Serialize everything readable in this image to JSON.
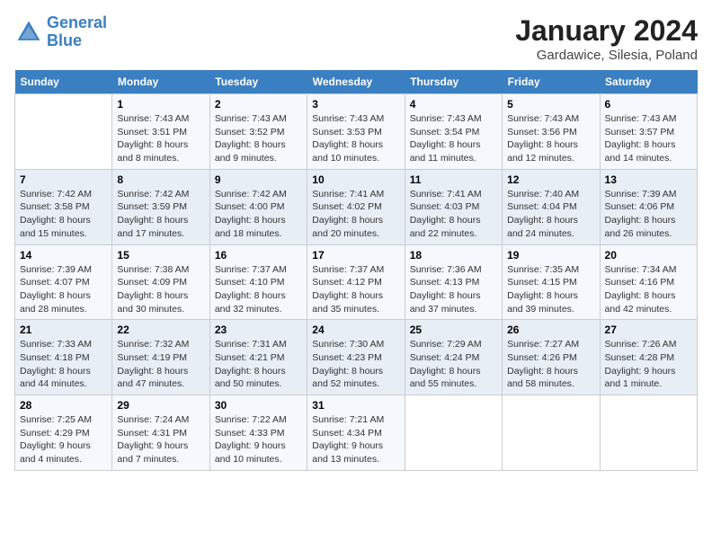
{
  "header": {
    "logo_text_part1": "General",
    "logo_text_part2": "Blue",
    "title": "January 2024",
    "subtitle": "Gardawice, Silesia, Poland"
  },
  "calendar": {
    "days_of_week": [
      "Sunday",
      "Monday",
      "Tuesday",
      "Wednesday",
      "Thursday",
      "Friday",
      "Saturday"
    ],
    "weeks": [
      [
        {
          "day": "",
          "info": ""
        },
        {
          "day": "1",
          "info": "Sunrise: 7:43 AM\nSunset: 3:51 PM\nDaylight: 8 hours\nand 8 minutes."
        },
        {
          "day": "2",
          "info": "Sunrise: 7:43 AM\nSunset: 3:52 PM\nDaylight: 8 hours\nand 9 minutes."
        },
        {
          "day": "3",
          "info": "Sunrise: 7:43 AM\nSunset: 3:53 PM\nDaylight: 8 hours\nand 10 minutes."
        },
        {
          "day": "4",
          "info": "Sunrise: 7:43 AM\nSunset: 3:54 PM\nDaylight: 8 hours\nand 11 minutes."
        },
        {
          "day": "5",
          "info": "Sunrise: 7:43 AM\nSunset: 3:56 PM\nDaylight: 8 hours\nand 12 minutes."
        },
        {
          "day": "6",
          "info": "Sunrise: 7:43 AM\nSunset: 3:57 PM\nDaylight: 8 hours\nand 14 minutes."
        }
      ],
      [
        {
          "day": "7",
          "info": "Sunrise: 7:42 AM\nSunset: 3:58 PM\nDaylight: 8 hours\nand 15 minutes."
        },
        {
          "day": "8",
          "info": "Sunrise: 7:42 AM\nSunset: 3:59 PM\nDaylight: 8 hours\nand 17 minutes."
        },
        {
          "day": "9",
          "info": "Sunrise: 7:42 AM\nSunset: 4:00 PM\nDaylight: 8 hours\nand 18 minutes."
        },
        {
          "day": "10",
          "info": "Sunrise: 7:41 AM\nSunset: 4:02 PM\nDaylight: 8 hours\nand 20 minutes."
        },
        {
          "day": "11",
          "info": "Sunrise: 7:41 AM\nSunset: 4:03 PM\nDaylight: 8 hours\nand 22 minutes."
        },
        {
          "day": "12",
          "info": "Sunrise: 7:40 AM\nSunset: 4:04 PM\nDaylight: 8 hours\nand 24 minutes."
        },
        {
          "day": "13",
          "info": "Sunrise: 7:39 AM\nSunset: 4:06 PM\nDaylight: 8 hours\nand 26 minutes."
        }
      ],
      [
        {
          "day": "14",
          "info": "Sunrise: 7:39 AM\nSunset: 4:07 PM\nDaylight: 8 hours\nand 28 minutes."
        },
        {
          "day": "15",
          "info": "Sunrise: 7:38 AM\nSunset: 4:09 PM\nDaylight: 8 hours\nand 30 minutes."
        },
        {
          "day": "16",
          "info": "Sunrise: 7:37 AM\nSunset: 4:10 PM\nDaylight: 8 hours\nand 32 minutes."
        },
        {
          "day": "17",
          "info": "Sunrise: 7:37 AM\nSunset: 4:12 PM\nDaylight: 8 hours\nand 35 minutes."
        },
        {
          "day": "18",
          "info": "Sunrise: 7:36 AM\nSunset: 4:13 PM\nDaylight: 8 hours\nand 37 minutes."
        },
        {
          "day": "19",
          "info": "Sunrise: 7:35 AM\nSunset: 4:15 PM\nDaylight: 8 hours\nand 39 minutes."
        },
        {
          "day": "20",
          "info": "Sunrise: 7:34 AM\nSunset: 4:16 PM\nDaylight: 8 hours\nand 42 minutes."
        }
      ],
      [
        {
          "day": "21",
          "info": "Sunrise: 7:33 AM\nSunset: 4:18 PM\nDaylight: 8 hours\nand 44 minutes."
        },
        {
          "day": "22",
          "info": "Sunrise: 7:32 AM\nSunset: 4:19 PM\nDaylight: 8 hours\nand 47 minutes."
        },
        {
          "day": "23",
          "info": "Sunrise: 7:31 AM\nSunset: 4:21 PM\nDaylight: 8 hours\nand 50 minutes."
        },
        {
          "day": "24",
          "info": "Sunrise: 7:30 AM\nSunset: 4:23 PM\nDaylight: 8 hours\nand 52 minutes."
        },
        {
          "day": "25",
          "info": "Sunrise: 7:29 AM\nSunset: 4:24 PM\nDaylight: 8 hours\nand 55 minutes."
        },
        {
          "day": "26",
          "info": "Sunrise: 7:27 AM\nSunset: 4:26 PM\nDaylight: 8 hours\nand 58 minutes."
        },
        {
          "day": "27",
          "info": "Sunrise: 7:26 AM\nSunset: 4:28 PM\nDaylight: 9 hours\nand 1 minute."
        }
      ],
      [
        {
          "day": "28",
          "info": "Sunrise: 7:25 AM\nSunset: 4:29 PM\nDaylight: 9 hours\nand 4 minutes."
        },
        {
          "day": "29",
          "info": "Sunrise: 7:24 AM\nSunset: 4:31 PM\nDaylight: 9 hours\nand 7 minutes."
        },
        {
          "day": "30",
          "info": "Sunrise: 7:22 AM\nSunset: 4:33 PM\nDaylight: 9 hours\nand 10 minutes."
        },
        {
          "day": "31",
          "info": "Sunrise: 7:21 AM\nSunset: 4:34 PM\nDaylight: 9 hours\nand 13 minutes."
        },
        {
          "day": "",
          "info": ""
        },
        {
          "day": "",
          "info": ""
        },
        {
          "day": "",
          "info": ""
        }
      ]
    ]
  }
}
